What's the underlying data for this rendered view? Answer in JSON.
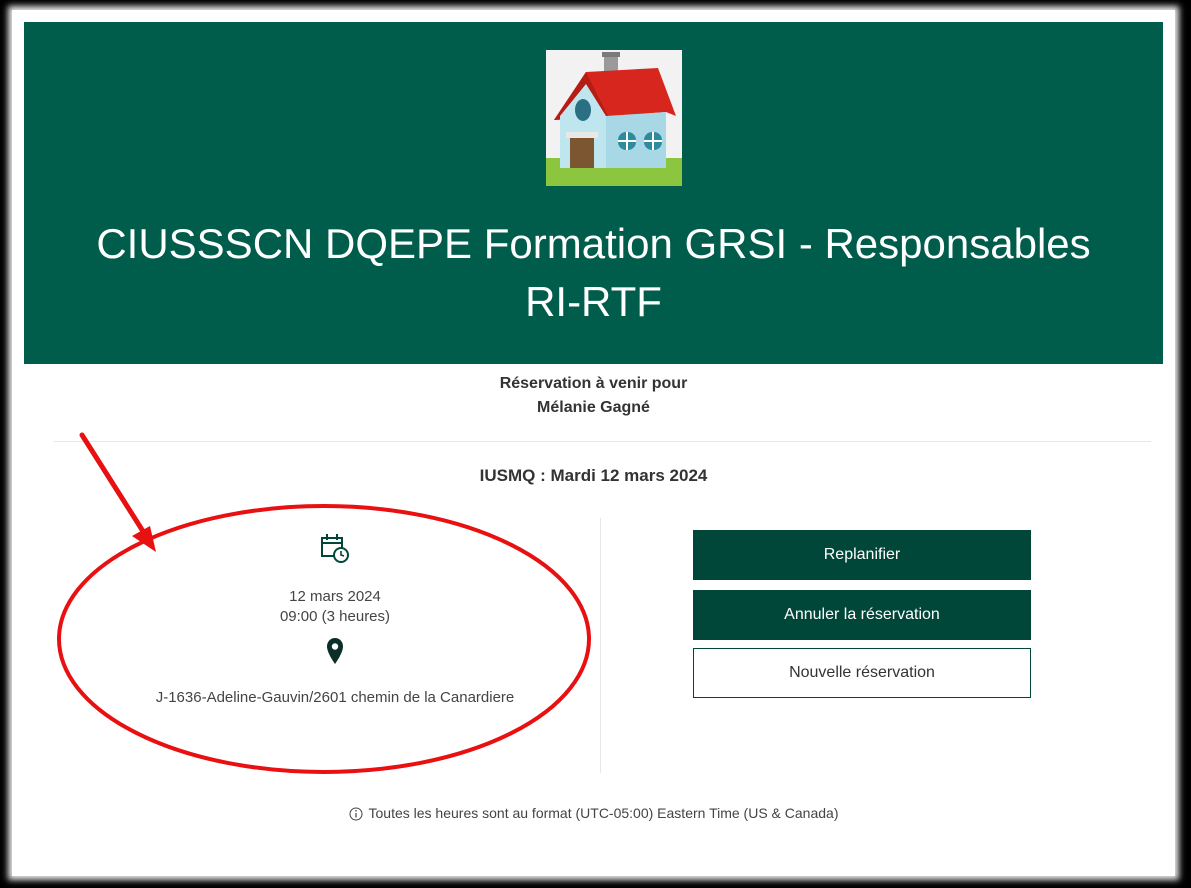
{
  "header": {
    "title_line1": "CIUSSSCN DQEPE Formation GRSI - Responsables",
    "title_line2": "RI-RTF",
    "logo_icon": "house-icon"
  },
  "booking": {
    "heading_line1": "Réservation à venir pour",
    "heading_line2": "Mélanie Gagné",
    "service_date": "IUSMQ : Mardi 12 mars 2024",
    "date": "12 mars 2024",
    "time": "09:00 (3 heures)",
    "location": "J-1636-Adeline-Gauvin/2601 chemin de la Canardiere"
  },
  "actions": {
    "reschedule": "Replanifier",
    "cancel": "Annuler la réservation",
    "new": "Nouvelle réservation"
  },
  "footer": {
    "timezone_note": "Toutes les heures sont au format (UTC-05:00) Eastern Time (US & Canada)"
  },
  "colors": {
    "header_bg": "#005c4b",
    "button_dark": "#004739",
    "annotation": "#e81010"
  }
}
